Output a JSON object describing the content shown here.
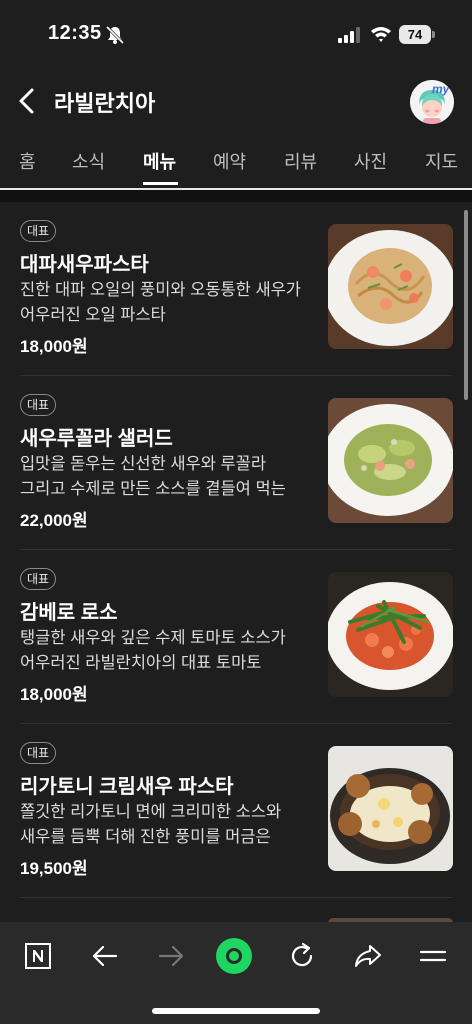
{
  "status_bar": {
    "time": "12:35",
    "battery": "74"
  },
  "header": {
    "title": "라빌란치아",
    "profile_badge": "my"
  },
  "tabs": [
    {
      "label": "홈"
    },
    {
      "label": "소식"
    },
    {
      "label": "메뉴",
      "active": true
    },
    {
      "label": "예약"
    },
    {
      "label": "리뷰"
    },
    {
      "label": "사진"
    },
    {
      "label": "지도"
    }
  ],
  "menu": {
    "items": [
      {
        "badge": "대표",
        "name": "대파새우파스타",
        "description": "진한 대파 오일의 풍미와 오동통한 새우가 어우러진 오일 파스타",
        "price": "18,000원"
      },
      {
        "badge": "대표",
        "name": "새우루꼴라 샐러드",
        "description": "입맛을 돋우는 신선한 새우와 루꼴라 그리고 수제로 만든 소스를 곁들여 먹는 샐러드",
        "price": "22,000원"
      },
      {
        "badge": "대표",
        "name": "감베로 로소",
        "description": "탱글한 새우와 깊은 수제 토마토 소스가 어우러진 라빌란치아의 대표 토마토 파스타",
        "price": "18,000원"
      },
      {
        "badge": "대표",
        "name": "리가토니 크림새우 파스타",
        "description": "쫄깃한 리가토니 면에 크리미한 소스와 새우를 듬뿍 더해 진한 풍미를 머금은 크림...",
        "price": "19,500원"
      }
    ]
  },
  "colors": {
    "background": "#1e1e1e",
    "accent_green": "#1ed760"
  }
}
